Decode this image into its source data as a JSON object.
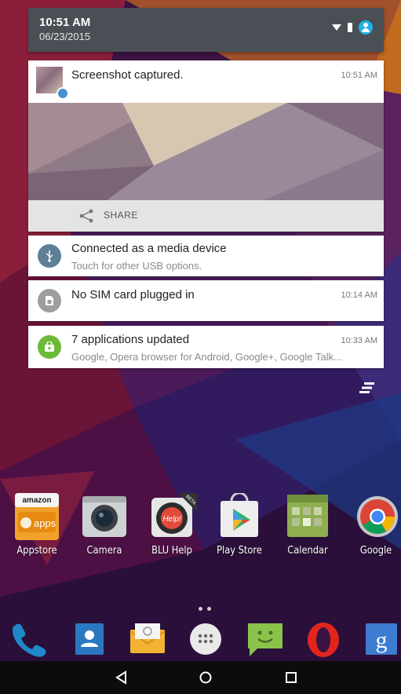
{
  "status": {
    "time": "10:51 AM",
    "date": "06/23/2015",
    "icons": [
      "wifi-icon",
      "battery-icon",
      "profile-icon"
    ],
    "accent": "#1fb4e6"
  },
  "notifications": {
    "screenshot": {
      "title": "Screenshot captured.",
      "time": "10:51 AM",
      "action": "SHARE"
    },
    "usb": {
      "title": "Connected as a media device",
      "subtitle": "Touch for other USB options.",
      "icon": "usb-icon",
      "color": "#5d7f97"
    },
    "sim": {
      "title": "No SIM card plugged in",
      "time": "10:14 AM",
      "icon": "sim-card-icon",
      "color": "#9e9e9e"
    },
    "updates": {
      "title": "7 applications updated",
      "time": "10:33 AM",
      "subtitle": "Google, Opera browser for Android, Google+, Google Talk...",
      "icon": "store-bag-icon",
      "color": "#6dba3a"
    }
  },
  "apps": [
    {
      "label": "Appstore",
      "icon": "amazon-appstore-icon"
    },
    {
      "label": "Camera",
      "icon": "camera-icon"
    },
    {
      "label": "BLU Help",
      "icon": "blu-help-icon"
    },
    {
      "label": "Play Store",
      "icon": "play-store-icon"
    },
    {
      "label": "Calendar",
      "icon": "calendar-icon"
    },
    {
      "label": "Google",
      "icon": "chrome-icon"
    }
  ],
  "appstore_badge": {
    "top": "amazon",
    "bottom": "apps"
  },
  "blu_help_badge": {
    "center": "Help!",
    "ribbon": "BETA"
  },
  "dock": [
    "phone-icon",
    "contacts-icon",
    "email-icon",
    "app-drawer-icon",
    "messaging-icon",
    "opera-icon",
    "google-search-icon"
  ],
  "dock_google_letter": "g",
  "navigation": [
    "back-icon",
    "home-icon",
    "recents-icon"
  ]
}
